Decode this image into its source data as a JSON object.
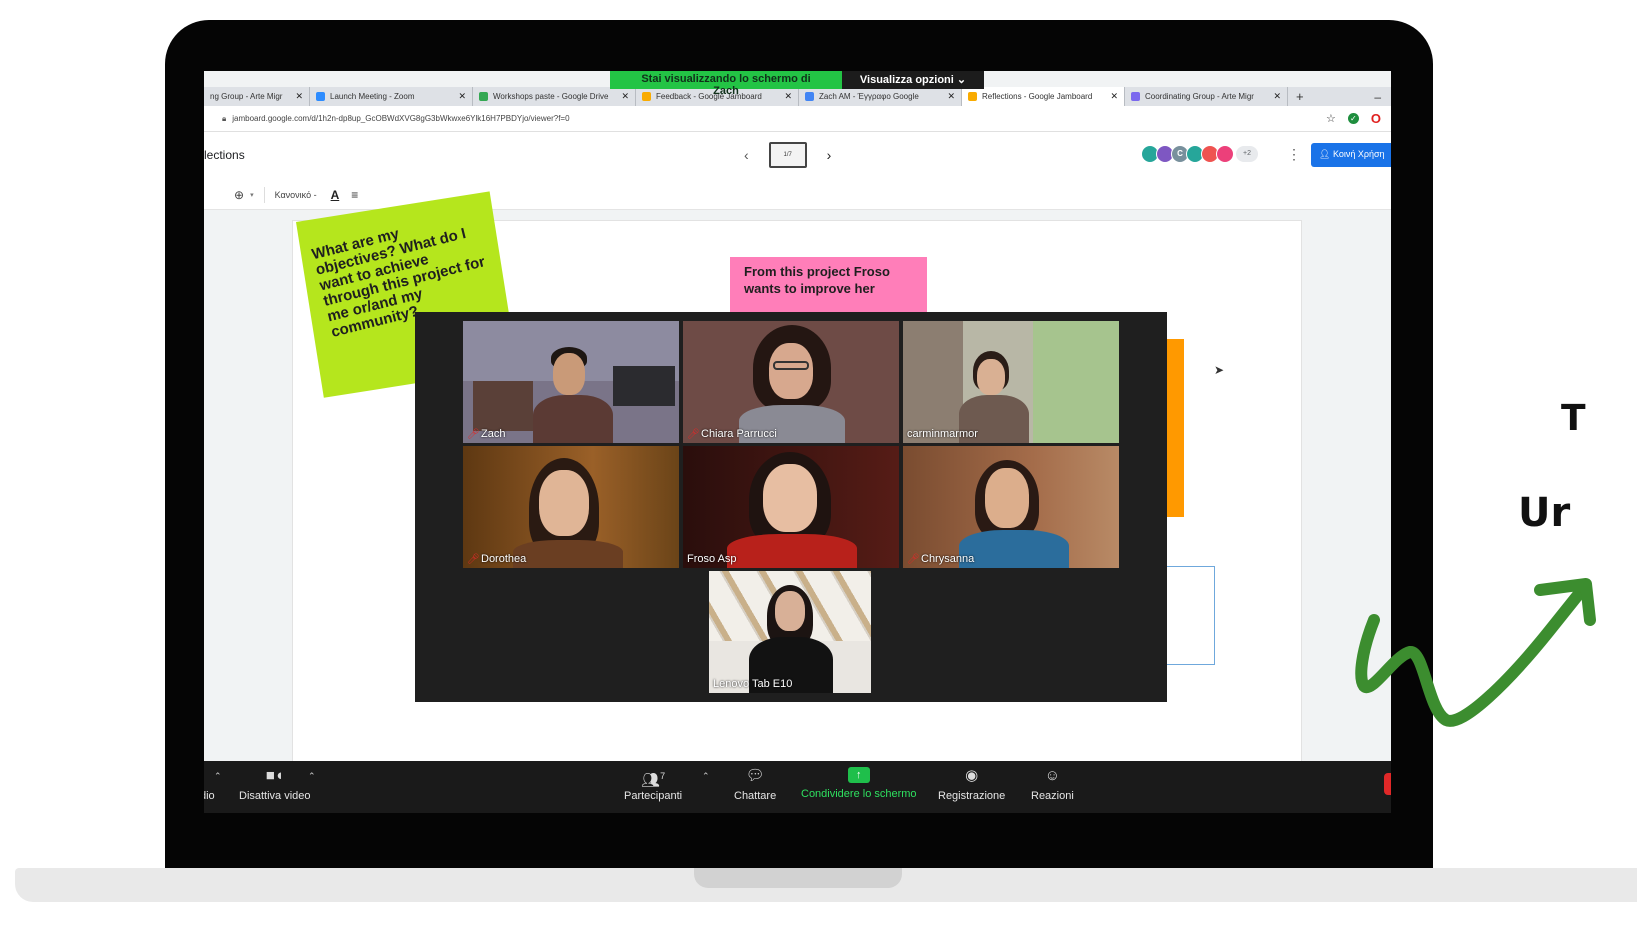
{
  "share_banner": {
    "viewing_text": "Stai visualizzando lo schermo di Zach",
    "options_label": "Visualizza opzioni ⌄"
  },
  "browser": {
    "tabs": [
      {
        "label": "ng Group - Arte Migr",
        "color": "#7b68ee"
      },
      {
        "label": "Launch Meeting - Zoom",
        "color": "#2d8cff"
      },
      {
        "label": "Workshops paste - Google Drive",
        "color": "#34a853"
      },
      {
        "label": "Feedback - Google Jamboard",
        "color": "#f9ab00"
      },
      {
        "label": "Zach AM - Έγγραφο Google",
        "color": "#4285f4"
      },
      {
        "label": "Reflections - Google Jamboard",
        "color": "#f9ab00",
        "active": true
      },
      {
        "label": "Coordinating Group - Arte Migr",
        "color": "#7b68ee"
      }
    ],
    "new_tab": "+",
    "url": "jamboard.google.com/d/1h2n-dp8up_GcOBWdXVG8gG3bWkwxe6Ylk16H7PBDYjo/viewer?f=0"
  },
  "jamboard": {
    "title": "lections",
    "frame_indicator": "1/7",
    "collaborators": [
      {
        "initial": "",
        "color": "#26a69a"
      },
      {
        "initial": "",
        "color": "#7e57c2"
      },
      {
        "initial": "C",
        "color": "#78909c"
      },
      {
        "initial": "",
        "color": "#26a69a"
      },
      {
        "initial": "",
        "color": "#ef5350"
      },
      {
        "initial": "",
        "color": "#ec407a"
      }
    ],
    "more_collaborators": "+2",
    "share_label": "Κοινή Χρήση",
    "font_select": "Κανονικό -",
    "sticky_green": "What are my objectives? What do I want to achieve through this project for me or/and my community?",
    "sticky_pink": "From this project Froso wants to improve her"
  },
  "zoom": {
    "participants": [
      {
        "name": "Zach",
        "muted": true
      },
      {
        "name": "Chiara Parrucci",
        "muted": true
      },
      {
        "name": "carminmarmor",
        "muted": false
      },
      {
        "name": "Dorothea",
        "muted": true
      },
      {
        "name": "Froso Asp",
        "muted": false,
        "speaking": true
      },
      {
        "name": "Chrysanna",
        "muted": true
      },
      {
        "name": "Lenovo Tab E10",
        "muted": false
      }
    ],
    "toolbar": {
      "audio": "dio",
      "video": "Disattiva video",
      "participants": "Partecipanti",
      "participants_count": "7",
      "chat": "Chattare",
      "share_screen": "Condividere lo schermo",
      "record": "Registrazione",
      "reactions": "Reazioni"
    }
  },
  "side_text": {
    "line1": "T",
    "line2": "Ur"
  },
  "colors": {
    "sticky_green": "#b5e61d",
    "sticky_pink": "#ff7eb9",
    "sticky_orange": "#ff9900",
    "share_green": "#23c445",
    "squiggle_green": "#3c8d2f"
  }
}
